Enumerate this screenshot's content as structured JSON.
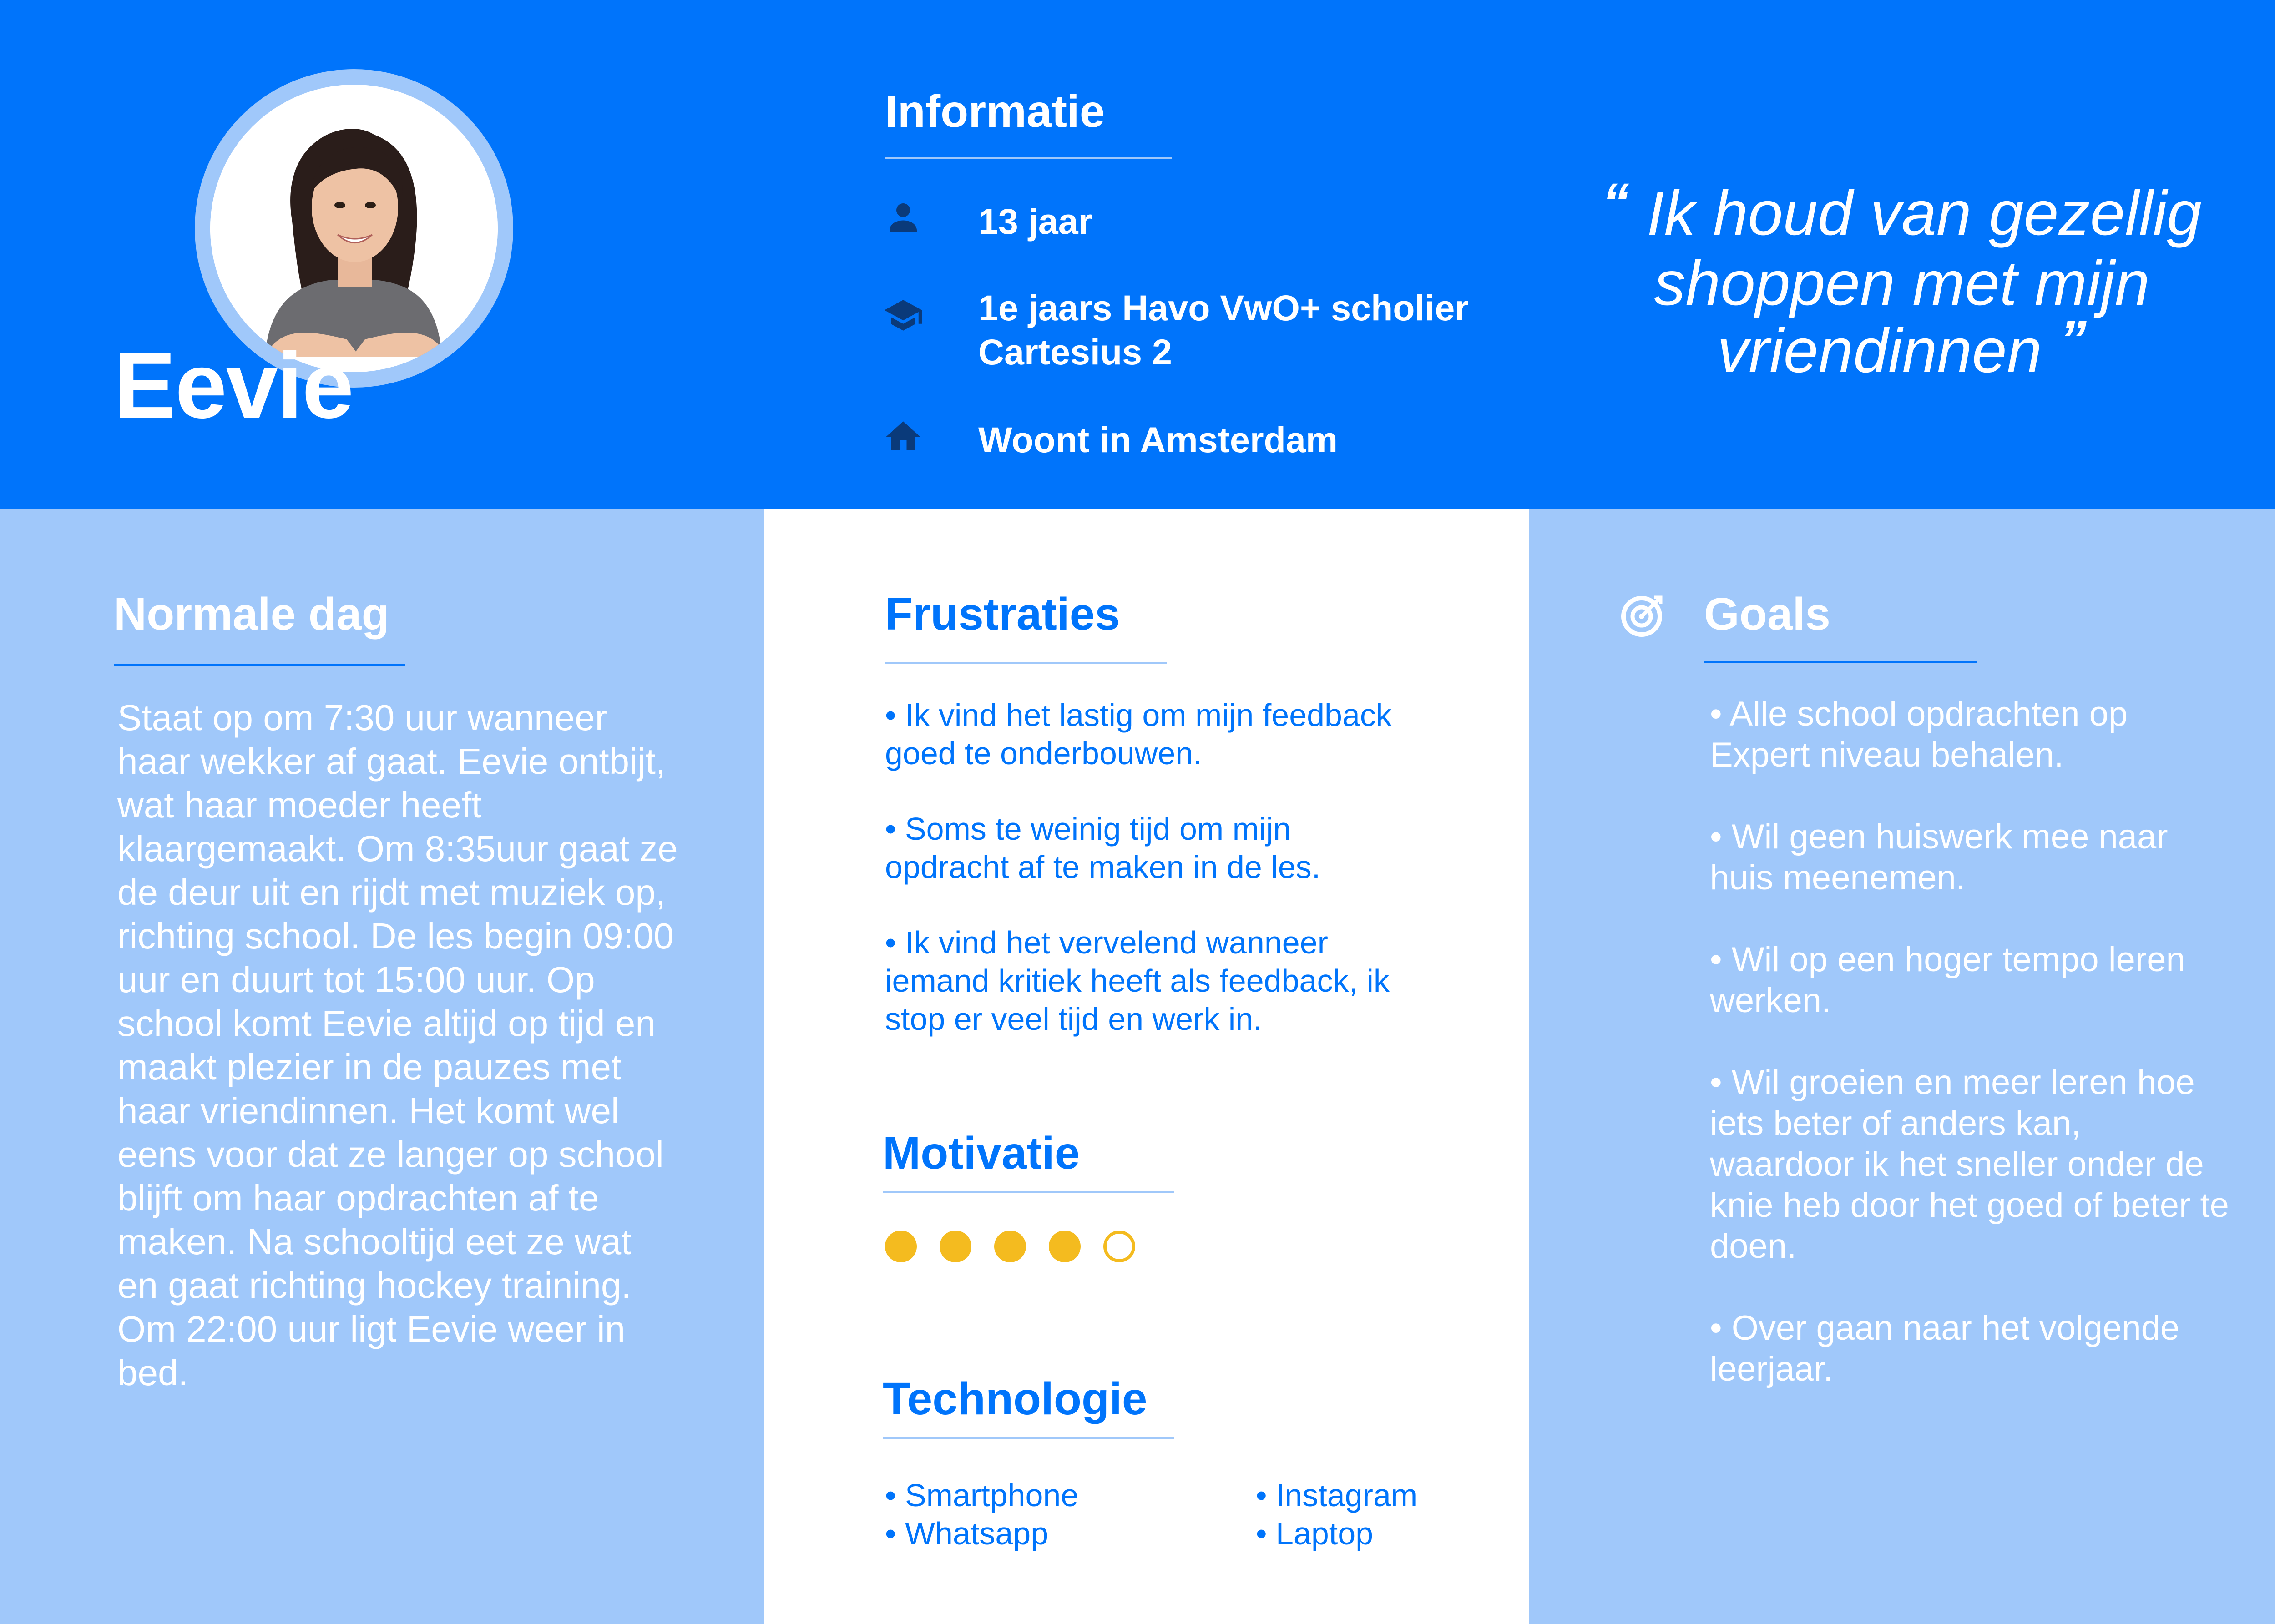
{
  "persona": {
    "name": "Eevie"
  },
  "informatie": {
    "title": "Informatie",
    "items": [
      {
        "icon": "person-icon",
        "text": "13 jaar"
      },
      {
        "icon": "graduation-cap-icon",
        "line1": "1e jaars Havo VwO+ scholier",
        "line2": "Cartesius 2"
      },
      {
        "icon": "home-icon",
        "text": "Woont in Amsterdam"
      }
    ]
  },
  "quote": {
    "open_mark": "“",
    "close_mark": "”",
    "line1": "Ik houd van gezellig",
    "line2": "shoppen met mijn",
    "line3": "vriendinnen"
  },
  "normale_dag": {
    "title": "Normale dag",
    "text": "Staat op om 7:30 uur wanneer haar wekker af gaat. Eevie ontbijt, wat haar moeder heeft klaargemaakt. Om 8:35uur gaat ze de deur uit en rijdt met muziek op, richting school. De les begin 09:00 uur en duurt tot 15:00 uur. Op school komt Eevie altijd op tijd en maakt plezier in de pauzes met haar vriendinnen. Het komt wel eens voor dat ze langer op school blijft om haar opdrachten af te maken. Na schooltijd  eet ze wat en gaat richting hockey training. Om 22:00 uur ligt Eevie weer in bed."
  },
  "frustraties": {
    "title": "Frustraties",
    "items": [
      "• Ik vind het lastig om mijn feedback goed te onderbouwen.",
      "• Soms te weinig tijd om mijn opdracht af te maken in de les.",
      "• Ik vind het vervelend wanneer iemand kritiek heeft als feedback, ik stop er veel tijd en werk in."
    ]
  },
  "motivatie": {
    "title": "Motivatie",
    "rating": 4,
    "max": 5,
    "filled_color": "#f4bb1f"
  },
  "technologie": {
    "title": "Technologie",
    "items": [
      "• Smartphone",
      "• Whatsapp",
      "• Instagram",
      "• Laptop"
    ]
  },
  "goals": {
    "title": "Goals",
    "icon": "target-icon",
    "items": [
      "• Alle school opdrachten op Expert niveau behalen.",
      "• Wil geen huiswerk mee naar huis meenemen.",
      "• Wil op een hoger tempo leren werken.",
      "• Wil groeien en meer leren hoe iets beter of anders kan, waardoor ik het sneller onder de knie heb door het goed of beter te doen.",
      "• Over gaan naar het volgende leerjaar."
    ]
  },
  "colors": {
    "primary": "#0074fb",
    "light": "#a0c8fa",
    "white": "#ffffff",
    "accent": "#f4bb1f"
  }
}
